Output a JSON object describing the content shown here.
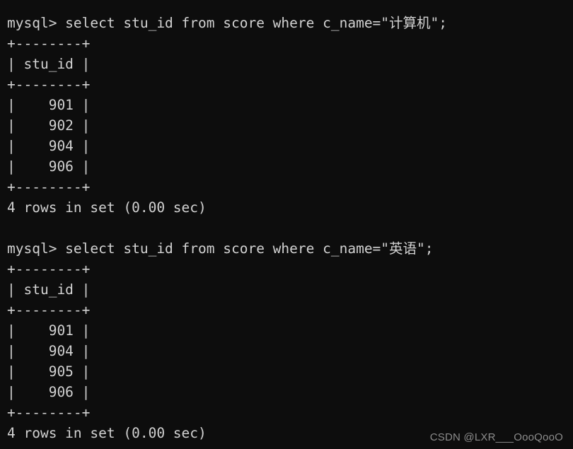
{
  "terminal": {
    "background_color": "#0d0d0d",
    "text_color": "#d2d2d2",
    "prompt": "mysql>",
    "blocks": [
      {
        "command_line": "mysql> select stu_id from score where c_name=\"计算机\";",
        "query": "select stu_id from score where c_name=\"计算机\";",
        "separator": "+--------+",
        "header_row": "| stu_id |",
        "columns": [
          "stu_id"
        ],
        "rows": [
          "|    901 |",
          "|    902 |",
          "|    904 |",
          "|    906 |"
        ],
        "values": [
          "901",
          "902",
          "904",
          "906"
        ],
        "status": "4 rows in set (0.00 sec)",
        "row_count": 4,
        "elapsed": "0.00 sec"
      },
      {
        "command_line": "mysql> select stu_id from score where c_name=\"英语\";",
        "query": "select stu_id from score where c_name=\"英语\";",
        "separator": "+--------+",
        "header_row": "| stu_id |",
        "columns": [
          "stu_id"
        ],
        "rows": [
          "|    901 |",
          "|    904 |",
          "|    905 |",
          "|    906 |"
        ],
        "values": [
          "901",
          "904",
          "905",
          "906"
        ],
        "status": "4 rows in set (0.00 sec)",
        "row_count": 4,
        "elapsed": "0.00 sec"
      }
    ]
  },
  "watermark": {
    "text": "CSDN @LXR___OooQooO",
    "color": "#8c8c8c"
  }
}
